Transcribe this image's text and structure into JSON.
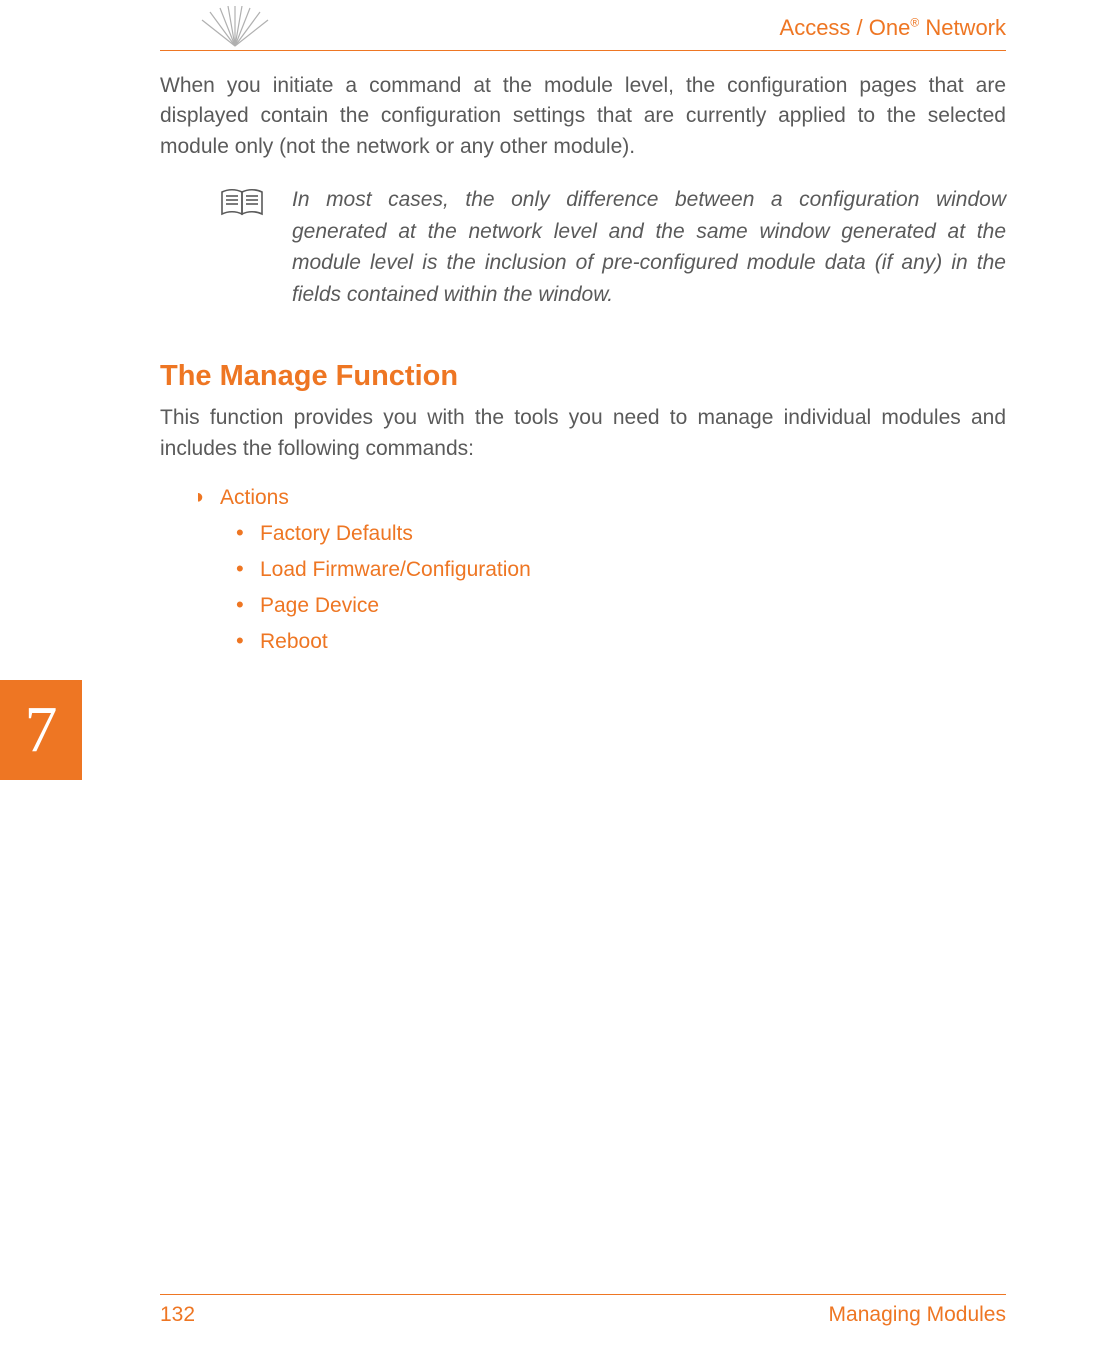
{
  "header": {
    "title_prefix": "Access / One",
    "title_suffix": " Network"
  },
  "intro_paragraph": "When you initiate a command at the module level, the configuration pages that are displayed contain the configuration settings that are currently applied to the selected module only (not the network or any other module).",
  "note": "In most cases, the only difference between a configuration window generated at the network level and the same window generated at the module level is the inclusion of pre-configured module data (if any) in the fields contained within the window.",
  "section": {
    "heading": "The Manage Function",
    "intro": "This function provides you with the tools you need to manage individual modules and includes the following commands:",
    "list": {
      "item": "Actions",
      "subitems": [
        "Factory Defaults",
        "Load Firmware/Configuration",
        "Page Device",
        "Reboot"
      ]
    }
  },
  "chapter_number": "7",
  "footer": {
    "page_number": "132",
    "section_name": "Managing Modules"
  }
}
